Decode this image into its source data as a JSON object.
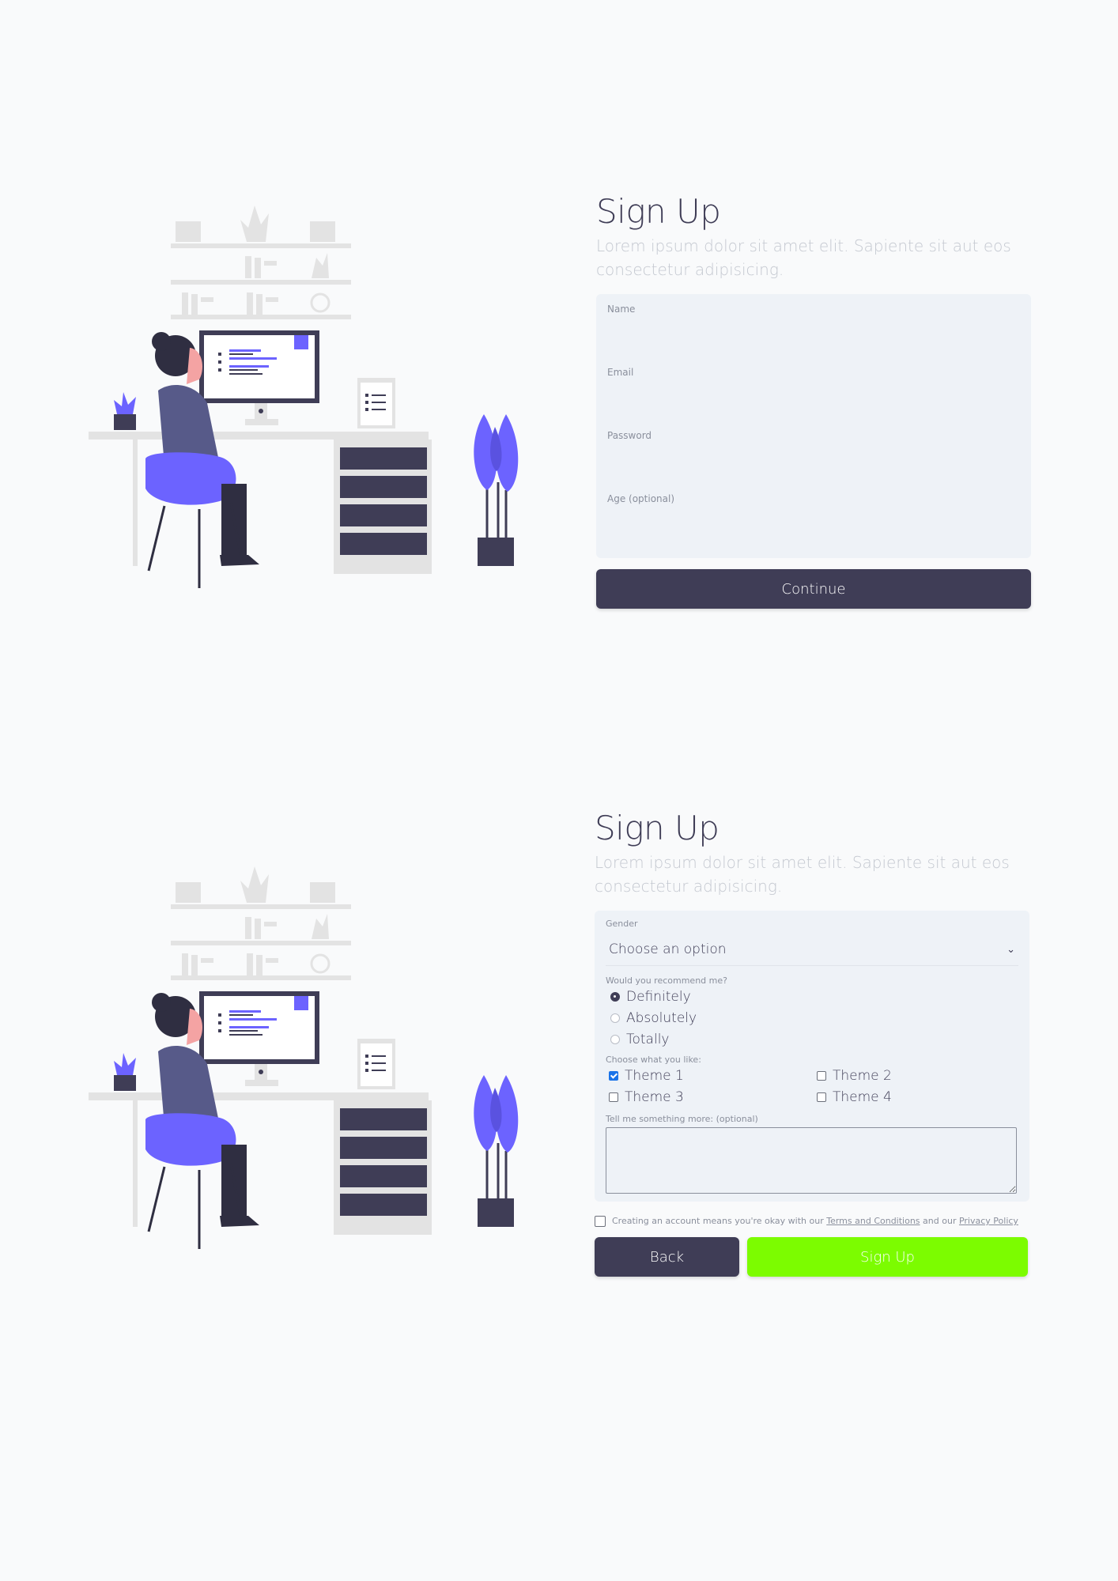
{
  "step1": {
    "title": "Sign Up",
    "subtitle": "Lorem ipsum dolor sit amet elit. Sapiente sit aut eos consectetur adipisicing.",
    "fields": [
      {
        "label": "Name",
        "value": ""
      },
      {
        "label": "Email",
        "value": ""
      },
      {
        "label": "Password",
        "value": ""
      },
      {
        "label": "Age (optional)",
        "value": ""
      }
    ],
    "continue_label": "Continue"
  },
  "step2": {
    "title": "Sign Up",
    "subtitle": "Lorem ipsum dolor sit amet elit. Sapiente sit aut eos consectetur adipisicing.",
    "gender": {
      "label": "Gender",
      "selected": "Choose an option"
    },
    "recommend": {
      "label": "Would you recommend me?",
      "options": [
        "Definitely",
        "Absolutely",
        "Totally"
      ],
      "selected": "Definitely"
    },
    "themes": {
      "label": "Choose what you like:",
      "options": [
        "Theme 1",
        "Theme 2",
        "Theme 3",
        "Theme 4"
      ],
      "checked": [
        "Theme 1"
      ]
    },
    "more": {
      "label": "Tell me something more: (optional)",
      "value": ""
    },
    "terms": {
      "prefix": "Creating an account means you're okay with our",
      "terms_link": "Terms and Conditions",
      "middle": "and our",
      "privacy_link": "Privacy Policy"
    },
    "back_label": "Back",
    "signup_label": "Sign Up"
  },
  "colors": {
    "primary_dark": "#3f3d56",
    "accent_purple": "#6c63ff",
    "signup_green": "#7cfc00",
    "form_bg": "#eef2f7"
  }
}
